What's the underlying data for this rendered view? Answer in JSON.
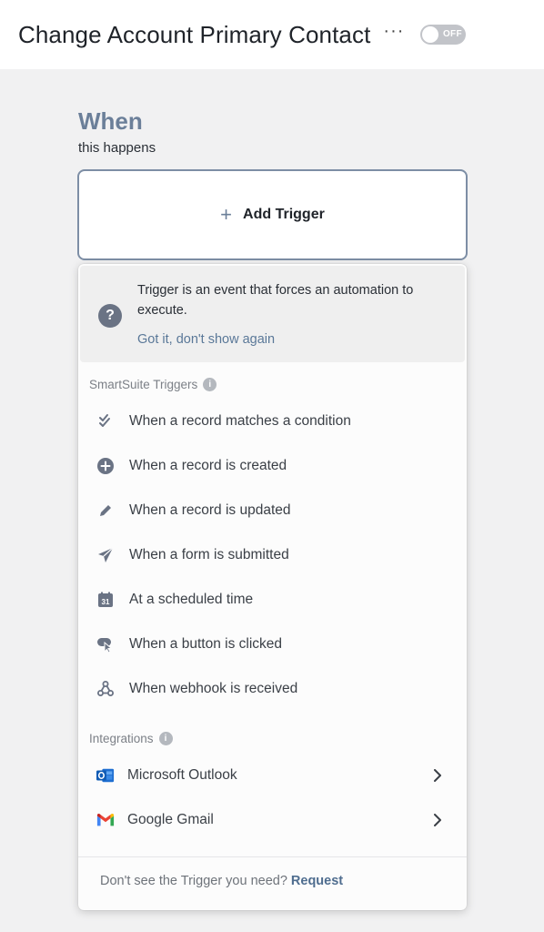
{
  "header": {
    "title": "Change Account Primary Contact",
    "more_label": "···",
    "toggle_label": "OFF"
  },
  "when": {
    "heading": "When",
    "subheading": "this happens",
    "add_trigger_label": "Add Trigger"
  },
  "info": {
    "text": "Trigger is an event that forces an automation to execute.",
    "dismiss_label": "Got it, don't show again"
  },
  "smartsuite_section": {
    "label": "SmartSuite Triggers",
    "items": [
      {
        "label": "When a record matches a condition",
        "icon": "double-check-icon"
      },
      {
        "label": "When a record is created",
        "icon": "plus-circle-icon"
      },
      {
        "label": "When a record is updated",
        "icon": "pencil-icon"
      },
      {
        "label": "When a form is submitted",
        "icon": "paper-plane-icon"
      },
      {
        "label": "At a scheduled time",
        "icon": "calendar-icon",
        "icon_text": "31"
      },
      {
        "label": "When a button is clicked",
        "icon": "cursor-click-icon"
      },
      {
        "label": "When webhook is received",
        "icon": "webhook-icon"
      }
    ]
  },
  "integrations_section": {
    "label": "Integrations",
    "items": [
      {
        "label": "Microsoft Outlook",
        "icon": "outlook-icon"
      },
      {
        "label": "Google Gmail",
        "icon": "gmail-icon"
      }
    ]
  },
  "footer": {
    "text": "Don't see the Trigger you need?",
    "link_label": "Request"
  },
  "colors": {
    "accent": "#6b7f99",
    "link": "#4f6d8f",
    "icon": "#6a7384",
    "background": "#f1f1f2"
  }
}
